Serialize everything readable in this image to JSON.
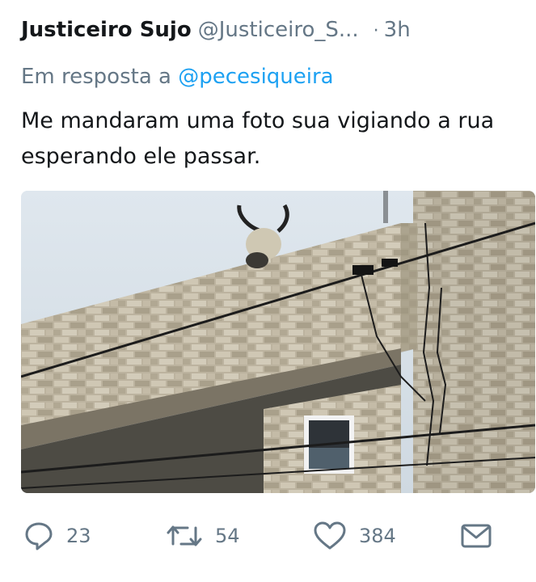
{
  "tweet": {
    "display_name": "Justiceiro Sujo",
    "handle": "@Justiceiro_S...",
    "separator": "·",
    "time": "3h",
    "reply_prefix": "Em resposta a",
    "reply_to": "@pecesiqueira",
    "text": "Me mandaram uma foto sua vigiando a rua esperando ele passar."
  },
  "actions": {
    "reply": {
      "icon": "reply-icon",
      "count": "23"
    },
    "retweet": {
      "icon": "retweet-icon",
      "count": "54"
    },
    "like": {
      "icon": "heart-icon",
      "count": "384"
    },
    "message": {
      "icon": "envelope-icon"
    }
  },
  "colors": {
    "primary_text": "#14171a",
    "secondary_text": "#657786",
    "mention": "#1da1f2"
  }
}
